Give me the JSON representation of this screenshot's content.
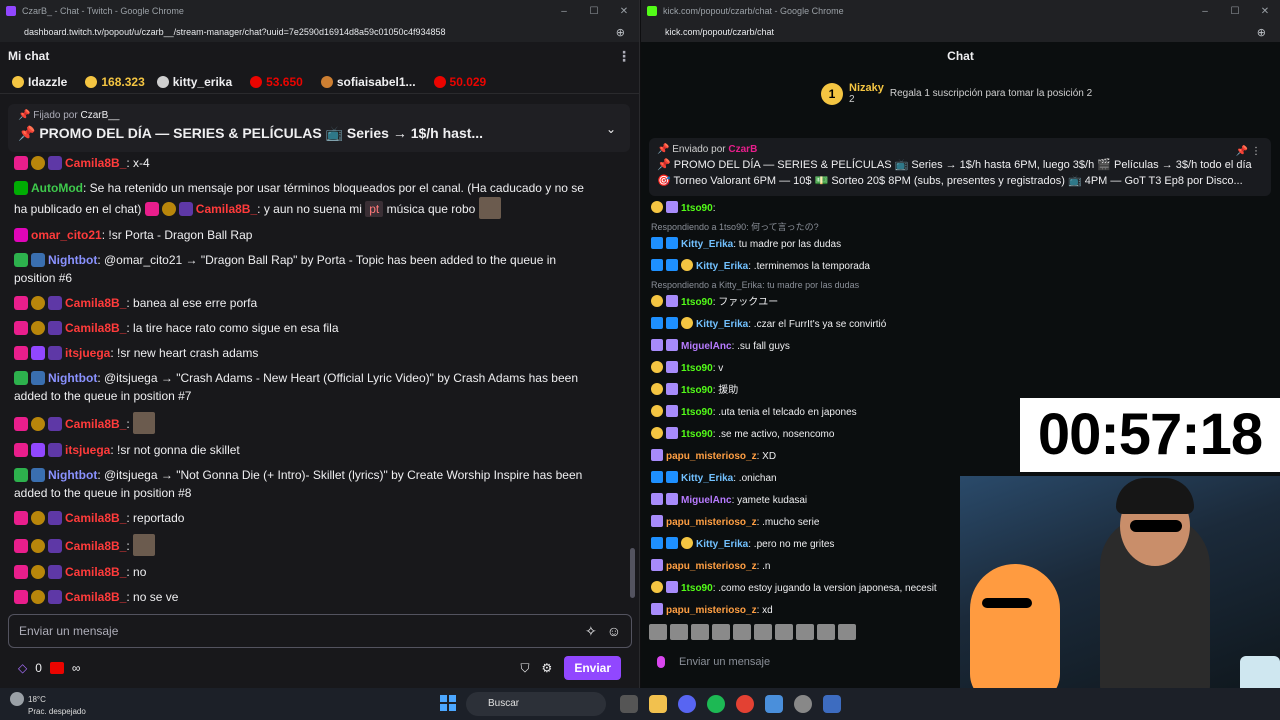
{
  "twitch_window": {
    "title": "CzarB_ - Chat - Twitch - Google Chrome",
    "url": "dashboard.twitch.tv/popout/u/czarb__/stream-manager/chat?uuid=7e2590d16914d8a59c01050c4f934858",
    "header": "Mi chat",
    "leaderboard": [
      {
        "name": "Idazzle"
      },
      {
        "gold": "168.323"
      },
      {
        "name": "kitty_erika"
      },
      {
        "red": "53.650"
      },
      {
        "name": "sofiaisabel1..."
      },
      {
        "red": "50.029"
      }
    ],
    "pinned": {
      "by_prefix": "Fijado por",
      "by_name": "CzarB__",
      "text": "📌 PROMO DEL DÍA — SERIES & PELÍCULAS 📺 Series → 1$/h hast..."
    },
    "messages": [
      {
        "user": "Camila8B_",
        "color": "red",
        "text": ": x-4"
      },
      {
        "user": "AutoMod",
        "color": "green",
        "text": ": Se ha retenido un mensaje por usar términos bloqueados por el canal. (Ha caducado y no se ha publicado en el chat)"
      },
      {
        "user": "Camila8B_",
        "color": "red",
        "text": ": y aun no suena mi",
        "tag": "pt",
        "tail": "música que robo"
      },
      {
        "user": "omar_cito21",
        "color": "red",
        "text": ": !sr Porta - Dragon Ball Rap"
      },
      {
        "user": "Nightbot",
        "color": "blue",
        "text": ": @omar_cito21 → \"Dragon Ball Rap\" by Porta - Topic has been added to the queue in position #6"
      },
      {
        "user": "Camila8B_",
        "color": "red",
        "text": ": banea al ese erre porfa"
      },
      {
        "user": "Camila8B_",
        "color": "red",
        "text": ": la tire hace rato como sigue en esa fila"
      },
      {
        "user": "itsjuega",
        "color": "red",
        "text": ": !sr new heart crash adams"
      },
      {
        "user": "Nightbot",
        "color": "blue",
        "text": ": @itsjuega → \"Crash Adams - New Heart (Official Lyric Video)\" by Crash Adams has been added to the queue in position #7"
      },
      {
        "user": "Camila8B_",
        "color": "red",
        "text": ":"
      },
      {
        "user": "itsjuega",
        "color": "red",
        "text": ": !sr not gonna die skillet"
      },
      {
        "user": "Nightbot",
        "color": "blue",
        "text": ": @itsjuega → \"Not Gonna Die (+ Intro)- Skillet (lyrics)\" by Create Worship Inspire has been added to the queue in position #8"
      },
      {
        "user": "Camila8B_",
        "color": "red",
        "text": ": reportado"
      },
      {
        "user": "Camila8B_",
        "color": "red",
        "text": ":"
      },
      {
        "user": "Camila8B_",
        "color": "red",
        "text": ": no"
      },
      {
        "user": "Camila8B_",
        "color": "red",
        "text": ": no se ve"
      }
    ],
    "input_placeholder": "Enviar un mensaje",
    "footer": {
      "points": "0",
      "infinity": "∞",
      "send": "Enviar"
    }
  },
  "kick_window": {
    "title": "kick.com/popout/czarb/chat - Google Chrome",
    "url": "kick.com/popout/czarb/chat",
    "header": "Chat",
    "top_gifter": {
      "rank": "1",
      "name": "Nizaky",
      "count": "2",
      "hint": "Regala 1 suscripción para tomar la posición 2"
    },
    "pinned": {
      "by_prefix": "Enviado por",
      "by_name": "CzarB",
      "line1": "📌 PROMO DEL DÍA — SERIES & PELÍCULAS 📺 Series → 1$/h hasta 6PM, luego 3$/h 🎬 Películas → 3$/h todo el día",
      "line2": "🎯 Torneo Valorant 6PM — 10$ 💵 Sorteo 20$ 8PM (subs, presentes y registrados) 📺 4PM — GoT T3 Ep8 por Disco..."
    },
    "messages": [
      {
        "user": "1tso90",
        "color": "c1",
        "text": ":"
      },
      {
        "reply": "Respondiendo a 1tso90: 何って言ったの?"
      },
      {
        "user": "Kitty_Erika",
        "color": "c2",
        "text": ": tu madre por las dudas"
      },
      {
        "user": "Kitty_Erika",
        "color": "c2",
        "text": ": .terminemos la temporada"
      },
      {
        "reply": "Respondiendo a Kitty_Erika: tu madre por las dudas"
      },
      {
        "user": "1tso90",
        "color": "c1",
        "text": ": ファックユー"
      },
      {
        "user": "Kitty_Erika",
        "color": "c2",
        "text": ": .czar el FurrIt's ya se convirtió"
      },
      {
        "user": "MiguelAnc",
        "color": "c3",
        "text": ": .su fall guys"
      },
      {
        "user": "1tso90",
        "color": "c1",
        "text": ": v"
      },
      {
        "user": "1tso90",
        "color": "c1",
        "text": ": 援助"
      },
      {
        "user": "1tso90",
        "color": "c1",
        "text": ": .uta tenia el telcado en japones"
      },
      {
        "user": "1tso90",
        "color": "c1",
        "text": ": .se me activo, nosencomo"
      },
      {
        "user": "papu_misterioso_z",
        "color": "c4",
        "text": ": XD"
      },
      {
        "user": "Kitty_Erika",
        "color": "c2",
        "text": ": .onichan"
      },
      {
        "user": "MiguelAnc",
        "color": "c3",
        "text": ": yamete kudasai"
      },
      {
        "user": "papu_misterioso_z",
        "color": "c4",
        "text": ": .mucho serie"
      },
      {
        "user": "Kitty_Erika",
        "color": "c2",
        "text": ": .pero no me grites"
      },
      {
        "user": "papu_misterioso_z",
        "color": "c4",
        "text": ": .n"
      },
      {
        "user": "1tso90",
        "color": "c1",
        "text": ": .como estoy jugando la version japonesa, necesit"
      },
      {
        "user": "papu_misterioso_z",
        "color": "c4",
        "text": ": xd"
      }
    ],
    "input_placeholder": "Enviar un mensaje"
  },
  "overlay": {
    "timer": "00:57:18"
  },
  "taskbar": {
    "temp": "18°C",
    "weather": "Prac. despejado",
    "search": "Buscar"
  }
}
